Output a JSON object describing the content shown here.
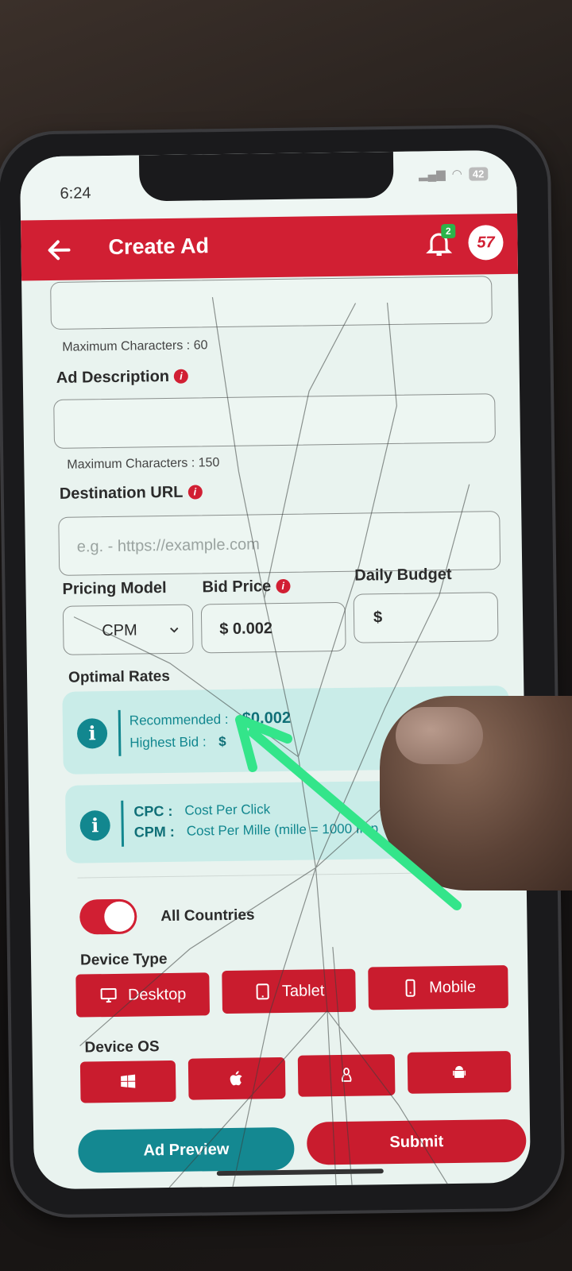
{
  "status_bar": {
    "time": "6:24",
    "battery": "42"
  },
  "appbar": {
    "title": "Create Ad",
    "notification_count": "2",
    "avatar_text": "57",
    "accent_color": "#d11f33"
  },
  "form": {
    "ad_title": {
      "helper": "Maximum Characters : 60",
      "value": ""
    },
    "ad_description": {
      "label": "Ad Description",
      "value": "",
      "helper": "Maximum Characters : 150"
    },
    "destination_url": {
      "label": "Destination URL",
      "placeholder": "e.g. - https://example.com",
      "value": ""
    },
    "pricing_model": {
      "label": "Pricing Model",
      "selected": "CPM"
    },
    "bid_price": {
      "label": "Bid Price",
      "value": "$ 0.002"
    },
    "daily_budget": {
      "label": "Daily Budget",
      "value": "$"
    }
  },
  "optimal_rates": {
    "label": "Optimal Rates",
    "recommended_label": "Recommended :",
    "recommended_value": "$0.002",
    "highest_label": "Highest Bid :",
    "highest_value": "$",
    "cpc_label": "CPC :",
    "cpc_text": "Cost Per Click",
    "cpm_label": "CPM :",
    "cpm_text": "Cost Per Mille (mille = 1000 Imp"
  },
  "targeting": {
    "all_countries_label": "All Countries",
    "all_countries_on": true,
    "device_type_label": "Device Type",
    "device_types": [
      "Desktop",
      "Tablet",
      "Mobile"
    ],
    "device_os_label": "Device OS",
    "device_os_icons": [
      "windows-icon",
      "apple-icon",
      "linux-icon",
      "android-icon"
    ]
  },
  "actions": {
    "preview_label": "Ad Preview",
    "submit_label": "Submit"
  }
}
